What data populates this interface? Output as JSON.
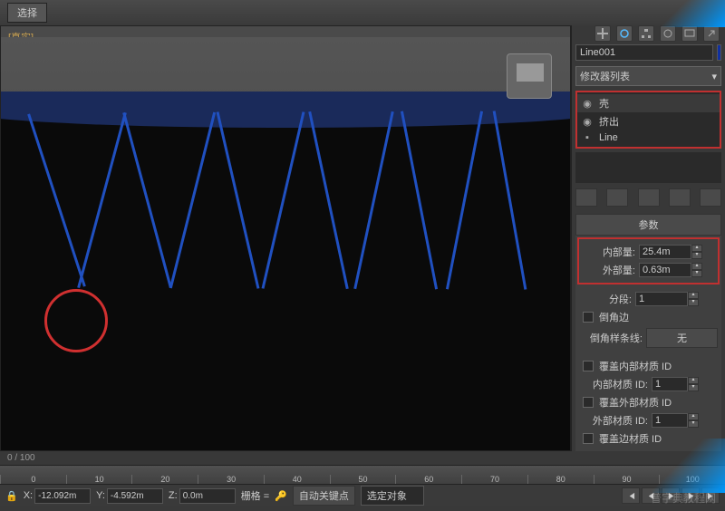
{
  "topbar": {
    "btn1": "选择"
  },
  "viewport": {
    "label": "[真实]"
  },
  "panel": {
    "object_name": "Line001",
    "modifier_list_label": "修改器列表",
    "stack": {
      "shell": "壳",
      "extrude": "挤出",
      "line": "Line"
    },
    "rollout_params": "参数",
    "inner_amount": {
      "label": "内部量:",
      "value": "25.4m"
    },
    "outer_amount": {
      "label": "外部量:",
      "value": "0.63m"
    },
    "segments": {
      "label": "分段:",
      "value": "1"
    },
    "bevel_edges": "倒角边",
    "bevel_spline": {
      "label": "倒角样条线:",
      "value": "无"
    },
    "override_inner_mat": "覆盖内部材质 ID",
    "inner_mat_id": {
      "label": "内部材质 ID:",
      "value": "1"
    },
    "override_outer_mat": "覆盖外部材质 ID",
    "outer_mat_id": {
      "label": "外部材质 ID:",
      "value": "1"
    },
    "override_edge_mat": "覆盖边材质 ID"
  },
  "timeline": {
    "frame_info": "0 / 100",
    "ticks": [
      "0",
      "10",
      "20",
      "30",
      "40",
      "50",
      "60",
      "70",
      "80",
      "90",
      "100"
    ]
  },
  "status": {
    "x_label": "X:",
    "x_value": "-12.092m",
    "y_label": "Y:",
    "y_value": "-4.592m",
    "z_label": "Z:",
    "z_value": "0.0m",
    "grid": "栅格 =",
    "autokey": "自动关键点",
    "selection": "选定对象"
  },
  "watermark": "普字典教程网"
}
